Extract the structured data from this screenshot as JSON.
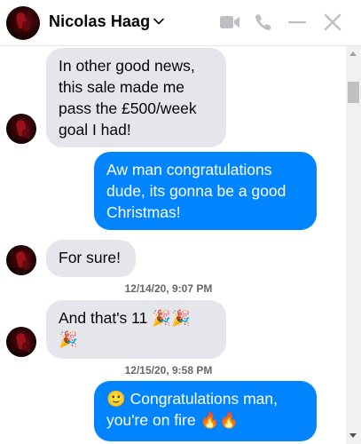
{
  "header": {
    "contact_name": "Nicolas Haag",
    "icons": [
      "chevron-down-icon",
      "video-call-icon",
      "phone-call-icon",
      "minimize-icon",
      "close-icon"
    ],
    "icon_color": "#bcc0c4"
  },
  "messages": [
    {
      "kind": "received",
      "text_lines": [
        "In other good news,",
        "this sale made me",
        "pass the £500/week",
        "goal I had!"
      ]
    },
    {
      "kind": "sent",
      "text_lines": [
        "Aw man congratulations",
        "dude, its gonna be a good",
        "Christmas!"
      ]
    },
    {
      "kind": "received",
      "text_lines": [
        "For sure!"
      ]
    },
    {
      "kind": "timestamp",
      "text": "12/14/20, 9:07 PM"
    },
    {
      "kind": "received",
      "text_lines": [
        "And that's 11 🎉🎉",
        "🎉"
      ]
    },
    {
      "kind": "timestamp",
      "text": "12/15/20, 9:58 PM"
    },
    {
      "kind": "sent",
      "text_lines": [
        "🙂 Congratulations man,",
        "you're on fire 🔥🔥"
      ]
    }
  ],
  "colors": {
    "sent_bubble": "#0084ff",
    "received_bubble": "#e4e6eb",
    "timestamp": "#65676b"
  }
}
